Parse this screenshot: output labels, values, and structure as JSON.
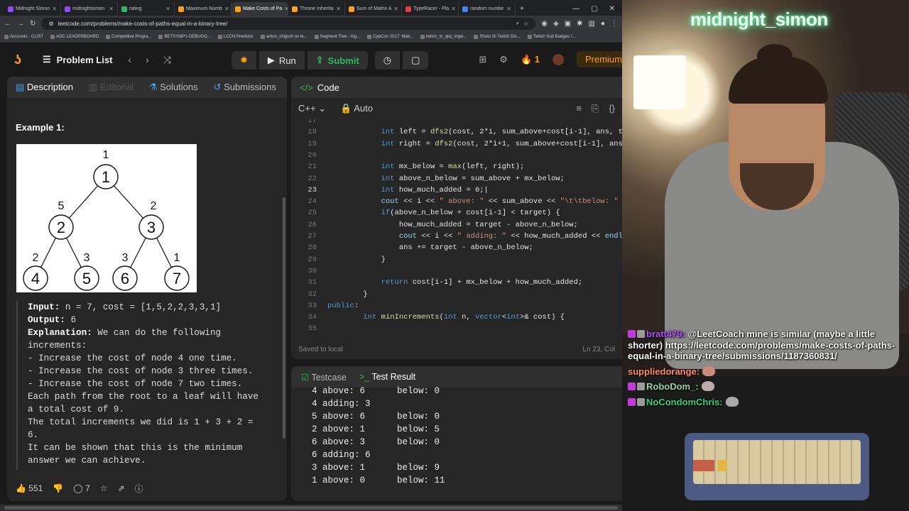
{
  "browser": {
    "tabs": [
      {
        "label": "Midnight Simon",
        "color": "#9147ff"
      },
      {
        "label": "midnightsimon",
        "color": "#9147ff"
      },
      {
        "label": "rating",
        "color": "#2cbb5d"
      },
      {
        "label": "Maximum Numb",
        "color": "#ffa116"
      },
      {
        "label": "Make Costs of Pa",
        "color": "#ffa116",
        "active": true
      },
      {
        "label": "Throne Inherita",
        "color": "#ffa116"
      },
      {
        "label": "Sum of Matrix A",
        "color": "#ffa116"
      },
      {
        "label": "TypeRacer - Pla",
        "color": "#e04040"
      },
      {
        "label": "random numbe",
        "color": "#4285f4"
      }
    ],
    "url": "leetcode.com/problems/make-costs-of-paths-equal-in-a-binary-tree/",
    "bookmarks": [
      "Accounts - CLIST",
      "AOC LEADERBOARD",
      "Competitive Progra...",
      "BETSYMP's DEBUGG...",
      "LCCN Predictor",
      "anton_chigurh on le...",
      "Segment Tree - Alg...",
      "CppCon 2017: Matt...",
      "twitch_tv_qiqi_impe...",
      "Shoto Gi Twitch Dis...",
      "Twitch Sub Badges /..."
    ]
  },
  "nav": {
    "problem_list": "Problem List",
    "run": "Run",
    "submit": "Submit",
    "streak": "1",
    "premium": "Premium"
  },
  "left": {
    "tabs": [
      "Description",
      "Editorial",
      "Solutions",
      "Submissions"
    ],
    "example_title": "Example 1:",
    "tree": {
      "nodes": [
        {
          "id": "1",
          "edge": "1"
        },
        {
          "id": "2",
          "edge": "5"
        },
        {
          "id": "3",
          "edge": "2"
        },
        {
          "id": "4",
          "edge": "2"
        },
        {
          "id": "5",
          "edge": "3"
        },
        {
          "id": "6",
          "edge": "3"
        },
        {
          "id": "7",
          "edge": "1"
        }
      ]
    },
    "input_label": "Input:",
    "input_value": " n = 7, cost = [1,5,2,2,3,3,1]",
    "output_label": "Output:",
    "output_value": " 6",
    "explanation_label": "Explanation:",
    "explanation_lines": [
      " We can do the following",
      "increments:",
      "- Increase the cost of node 4 one time.",
      "- Increase the cost of node 3 three times.",
      "- Increase the cost of node 7 two times.",
      "Each path from the root to a leaf will have",
      "a total cost of 9.",
      "The total increments we did is 1 + 3 + 2 =",
      "6.",
      "It can be shown that this is the minimum",
      "answer we can achieve."
    ],
    "likes": "551",
    "comments": "7"
  },
  "editor": {
    "tab": "Code",
    "language": "C++",
    "mode": "Auto",
    "saved": "Saved to local",
    "cursor": "Ln 23, Col",
    "lines": [
      {
        "n": "17",
        "code": ""
      },
      {
        "n": "18",
        "code": "            int left = dfs2(cost, 2*i, sum_above+cost[i-1], ans, tar"
      },
      {
        "n": "19",
        "code": "            int right = dfs2(cost, 2*i+1, sum_above+cost[i-1], ans,"
      },
      {
        "n": "20",
        "code": ""
      },
      {
        "n": "21",
        "code": "            int mx_below = max(left, right);"
      },
      {
        "n": "22",
        "code": "            int above_n_below = sum_above + mx_below;"
      },
      {
        "n": "23",
        "code": "            int how_much_added = 0;|"
      },
      {
        "n": "24",
        "code": "            cout << i << \" above: \" << sum_above << \"\\t\\tbelow: \" <<"
      },
      {
        "n": "25",
        "code": "            if(above_n_below + cost[i-1] < target) {"
      },
      {
        "n": "26",
        "code": "                how_much_added = target - above_n_below;"
      },
      {
        "n": "27",
        "code": "                cout << i << \" adding: \" << how_much_added << endl;"
      },
      {
        "n": "28",
        "code": "                ans += target - above_n_below;"
      },
      {
        "n": "29",
        "code": "            }"
      },
      {
        "n": "30",
        "code": ""
      },
      {
        "n": "31",
        "code": "            return cost[i-1] + mx_below + how_much_added;"
      },
      {
        "n": "32",
        "code": "        }"
      },
      {
        "n": "33",
        "code": "public:"
      },
      {
        "n": "34",
        "code": "        int minIncrements(int n, vector<int>& cost) {"
      },
      {
        "n": "35",
        "code": ""
      }
    ]
  },
  "result": {
    "tabs": [
      "Testcase",
      "Test Result"
    ],
    "lines": [
      "4 above: 6      below: 0",
      "4 adding: 3",
      "5 above: 6      below: 0",
      "2 above: 1      below: 5",
      "6 above: 3      below: 0",
      "6 adding: 6",
      "3 above: 1      below: 9",
      "1 above: 0      below: 11"
    ]
  },
  "stream": {
    "channel": "midnight_simon",
    "chat": [
      {
        "user": "bratt479:",
        "msg": "@LeetCoach mine is similar (maybe a little shorter) https://leetcode.com/problems/make-costs-of-paths-equal-in-a-binary-tree/submissions/1187360831/"
      },
      {
        "user": "suppliedorange:",
        "msg": ""
      },
      {
        "user": "RoboDom_:",
        "msg": ""
      },
      {
        "user": "NoCondomChris:",
        "msg": ""
      }
    ]
  },
  "colors": {
    "accent": "#ffa116",
    "green": "#2cbb5d",
    "panel": "#262626"
  }
}
